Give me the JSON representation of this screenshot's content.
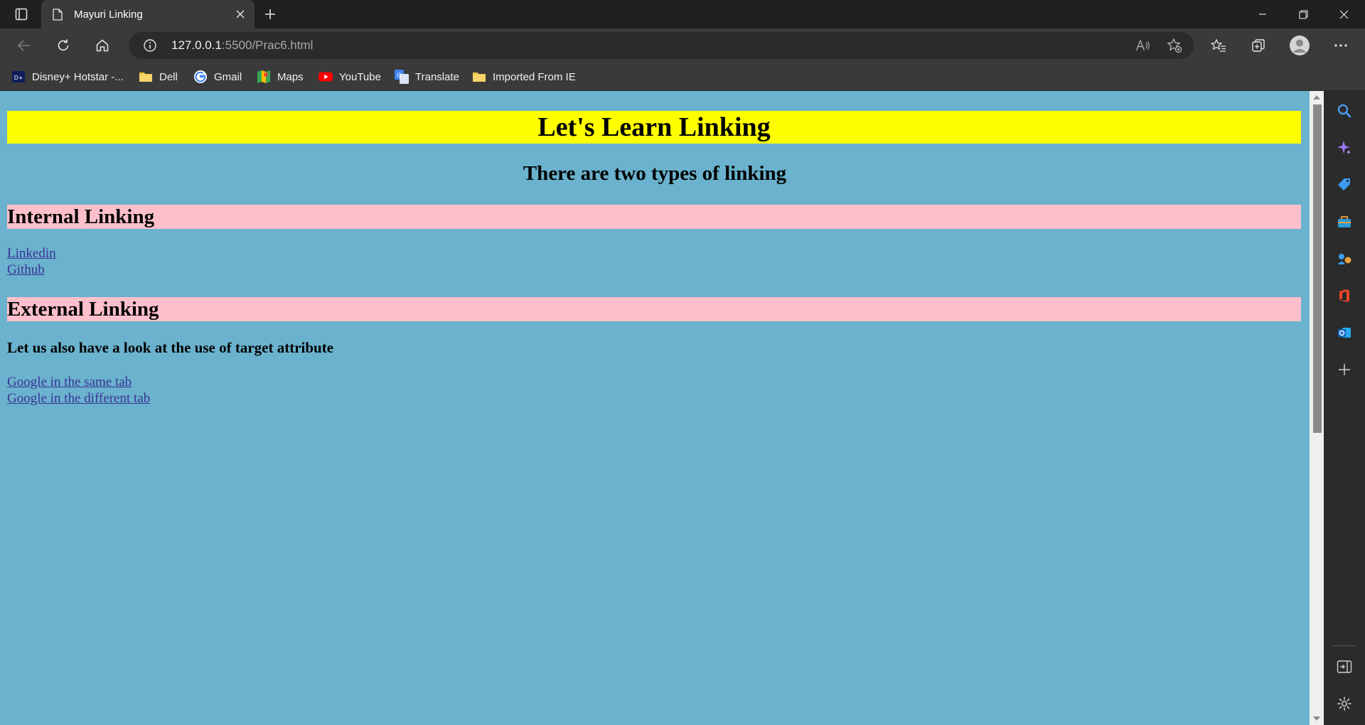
{
  "browser": {
    "tab_title": "Mayuri Linking",
    "url_host": "127.0.0.1",
    "url_path": ":5500/Prac6.html"
  },
  "bookmarks": [
    {
      "label": "Disney+ Hotstar -...",
      "icon": "hotstar-icon"
    },
    {
      "label": "Dell",
      "icon": "folder-icon"
    },
    {
      "label": "Gmail",
      "icon": "google-icon"
    },
    {
      "label": "Maps",
      "icon": "maps-icon"
    },
    {
      "label": "YouTube",
      "icon": "youtube-icon"
    },
    {
      "label": "Translate",
      "icon": "translate-icon"
    },
    {
      "label": "Imported From IE",
      "icon": "folder-icon"
    }
  ],
  "page": {
    "heading": "Let's Learn Linking",
    "subheading": "There are two types of linking",
    "internal_heading": "Internal Linking",
    "internal_links": [
      "Linkedin",
      "Github"
    ],
    "external_heading": "External Linking",
    "target_note": "Let us also have a look at the use of target attribute",
    "external_links": [
      "Google in the same tab",
      "Google in the different tab"
    ]
  },
  "colors": {
    "page_bg": "#6ab2cd",
    "heading_bg": "#ffff00",
    "section_bg": "#ffc0cb",
    "link": "#3a3396"
  }
}
